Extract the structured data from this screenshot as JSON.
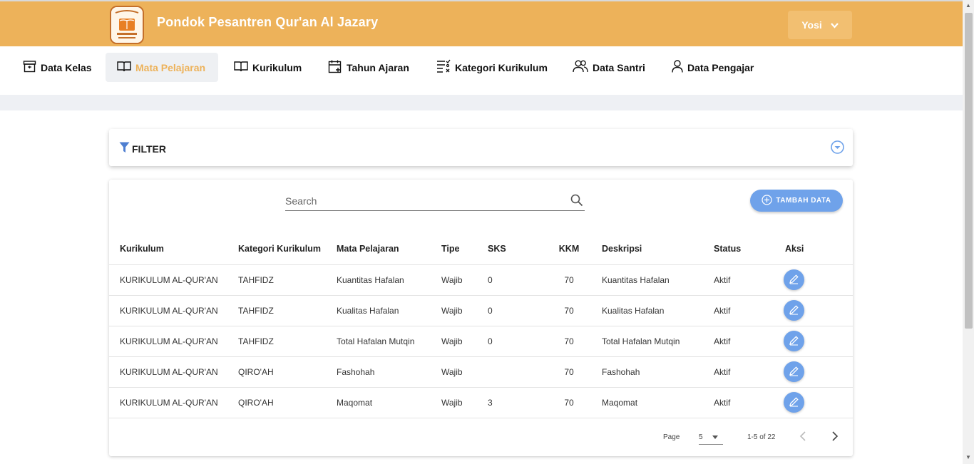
{
  "header": {
    "app_title": "Pondok Pesantren Qur'an Al Jazary",
    "user_name": "Yosi"
  },
  "nav": {
    "items": [
      {
        "label": "Data Kelas",
        "icon": "archive-box-icon"
      },
      {
        "label": "Mata Pelajaran",
        "icon": "book-open-icon",
        "active": true
      },
      {
        "label": "Kurikulum",
        "icon": "book-open-icon"
      },
      {
        "label": "Tahun Ajaran",
        "icon": "calendar-plus-icon"
      },
      {
        "label": "Kategori Kurikulum",
        "icon": "checklist-icon"
      },
      {
        "label": "Data Santri",
        "icon": "users-icon"
      },
      {
        "label": "Data Pengajar",
        "icon": "user-icon"
      }
    ]
  },
  "filter": {
    "label": "FILTER"
  },
  "search": {
    "placeholder": "Search"
  },
  "toolbar": {
    "add_label": "TAMBAH DATA"
  },
  "table": {
    "columns": [
      "Kurikulum",
      "Kategori Kurikulum",
      "Mata Pelajaran",
      "Tipe",
      "SKS",
      "KKM",
      "Deskripsi",
      "Status",
      "Aksi"
    ],
    "rows": [
      {
        "kurikulum": "KURIKULUM AL-QUR'AN",
        "kategori": "TAHFIDZ",
        "mapel": "Kuantitas Hafalan",
        "tipe": "Wajib",
        "sks": "0",
        "kkm": "70",
        "deskripsi": "Kuantitas Hafalan",
        "status": "Aktif"
      },
      {
        "kurikulum": "KURIKULUM AL-QUR'AN",
        "kategori": "TAHFIDZ",
        "mapel": "Kualitas Hafalan",
        "tipe": "Wajib",
        "sks": "0",
        "kkm": "70",
        "deskripsi": "Kualitas Hafalan",
        "status": "Aktif"
      },
      {
        "kurikulum": "KURIKULUM AL-QUR'AN",
        "kategori": "TAHFIDZ",
        "mapel": "Total Hafalan Mutqin",
        "tipe": "Wajib",
        "sks": "0",
        "kkm": "70",
        "deskripsi": "Total Hafalan Mutqin",
        "status": "Aktif"
      },
      {
        "kurikulum": "KURIKULUM AL-QUR'AN",
        "kategori": "QIRO'AH",
        "mapel": "Fashohah",
        "tipe": "Wajib",
        "sks": "",
        "kkm": "70",
        "deskripsi": "Fashohah",
        "status": "Aktif"
      },
      {
        "kurikulum": "KURIKULUM AL-QUR'AN",
        "kategori": "QIRO'AH",
        "mapel": "Maqomat",
        "tipe": "Wajib",
        "sks": "3",
        "kkm": "70",
        "deskripsi": "Maqomat",
        "status": "Aktif"
      }
    ]
  },
  "pagination": {
    "page_label": "Page",
    "page_size": "5",
    "range": "1-5 of 22"
  },
  "colors": {
    "brand": "#edb25a",
    "accent": "#6fa2ea"
  }
}
